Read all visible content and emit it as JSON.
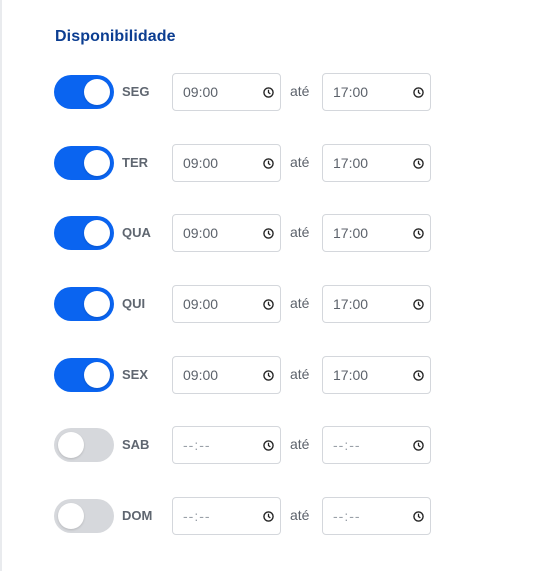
{
  "section": {
    "title": "Disponibilidade"
  },
  "separator": "até",
  "days": [
    {
      "label": "SEG",
      "enabled": true,
      "start": "09:00",
      "end": "17:00"
    },
    {
      "label": "TER",
      "enabled": true,
      "start": "09:00",
      "end": "17:00"
    },
    {
      "label": "QUA",
      "enabled": true,
      "start": "09:00",
      "end": "17:00"
    },
    {
      "label": "QUI",
      "enabled": true,
      "start": "09:00",
      "end": "17:00"
    },
    {
      "label": "SEX",
      "enabled": true,
      "start": "09:00",
      "end": "17:00"
    },
    {
      "label": "SAB",
      "enabled": false,
      "start": "--:--",
      "end": "--:--"
    },
    {
      "label": "DOM",
      "enabled": false,
      "start": "--:--",
      "end": "--:--"
    }
  ],
  "colors": {
    "toggle_on": "#0a64f0",
    "toggle_off": "#d6d8dc",
    "title": "#0b3d91"
  },
  "icons": {
    "time_field": "clock-icon"
  }
}
